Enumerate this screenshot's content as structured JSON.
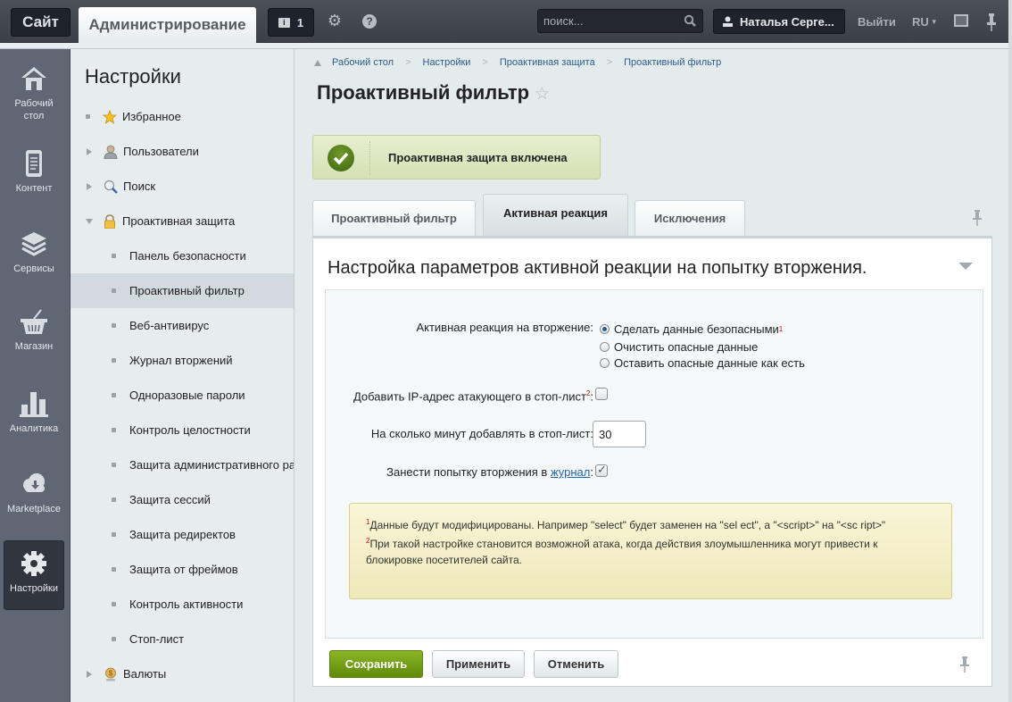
{
  "topbar": {
    "site_label": "Сайт",
    "admin_label": "Администрирование",
    "notifications_count": "1",
    "search_placeholder": "поиск...",
    "user_name": "Наталья Серге...",
    "logout_label": "Выйти",
    "language": "RU"
  },
  "leftnav": {
    "items": [
      {
        "label": "Рабочий стол",
        "icon": "home-icon"
      },
      {
        "label": "Контент",
        "icon": "document-icon"
      },
      {
        "label": "Сервисы",
        "icon": "layers-icon"
      },
      {
        "label": "Магазин",
        "icon": "basket-icon"
      },
      {
        "label": "Аналитика",
        "icon": "bar-chart-icon"
      },
      {
        "label": "Marketplace",
        "icon": "cloud-download-icon"
      },
      {
        "label": "Настройки",
        "icon": "gear-icon",
        "active": true
      }
    ]
  },
  "sidebar": {
    "title": "Настройки",
    "items": [
      {
        "label": "Избранное",
        "level": 1,
        "icon": "star-icon"
      },
      {
        "label": "Пользователи",
        "level": 1,
        "icon": "user-icon",
        "expandable": true
      },
      {
        "label": "Поиск",
        "level": 1,
        "icon": "magnifier-icon",
        "expandable": true
      },
      {
        "label": "Проактивная защита",
        "level": 1,
        "icon": "padlock-icon",
        "expanded": true
      },
      {
        "label": "Панель безопасности",
        "level": 2
      },
      {
        "label": "Проактивный фильтр",
        "level": 2,
        "active": true
      },
      {
        "label": "Веб-антивирус",
        "level": 2
      },
      {
        "label": "Журнал вторжений",
        "level": 2
      },
      {
        "label": "Одноразовые пароли",
        "level": 2
      },
      {
        "label": "Контроль целостности",
        "level": 2
      },
      {
        "label": "Защита административного ра",
        "level": 2
      },
      {
        "label": "Защита сессий",
        "level": 2
      },
      {
        "label": "Защита редиректов",
        "level": 2
      },
      {
        "label": "Защита от фреймов",
        "level": 2
      },
      {
        "label": "Контроль активности",
        "level": 2
      },
      {
        "label": "Стоп-лист",
        "level": 2
      },
      {
        "label": "Валюты",
        "level": 1,
        "icon": "currency-icon",
        "expandable": true
      }
    ]
  },
  "breadcrumb": [
    "Рабочий стол",
    "Настройки",
    "Проактивная защита",
    "Проактивный фильтр"
  ],
  "page": {
    "title": "Проактивный фильтр",
    "status_notice": "Проактивная защита включена"
  },
  "tabs": [
    {
      "label": "Проактивный фильтр"
    },
    {
      "label": "Активная реакция",
      "active": true
    },
    {
      "label": "Исключения"
    }
  ],
  "form": {
    "section_title": "Настройка параметров активной реакции на попытку вторжения.",
    "reaction_label": "Активная реакция на вторжение:",
    "reaction_options": [
      {
        "label": "Сделать данные безопасными",
        "note": "1",
        "selected": true
      },
      {
        "label": "Очистить опасные данные",
        "selected": false
      },
      {
        "label": "Оставить опасные данные как есть",
        "selected": false
      }
    ],
    "add_ip_label": "Добавить IP-адрес атакующего в стоп-лист",
    "add_ip_note": "2",
    "add_ip_checked": false,
    "minutes_label": "На сколько минут добавлять в стоп-лист:",
    "minutes_value": "30",
    "log_label_prefix": "Занести попытку вторжения в ",
    "log_link": "журнал",
    "log_checked": true,
    "hint_1_num": "1",
    "hint_1": "Данные будут модифицированы. Например \"select\" будет заменен на \"sel ect\", а \"<script>\" на \"<sc ript>\"",
    "hint_2_num": "2",
    "hint_2": "При такой настройке становится возможной атака, когда действия злоумышленника могут привести к блокировке посетителей сайта."
  },
  "buttons": {
    "save": "Сохранить",
    "apply": "Применить",
    "cancel": "Отменить"
  },
  "colors": {
    "save_button": "#7aa418",
    "link": "#2067b0",
    "footnote": "#d01010",
    "topbar": "#43474e"
  }
}
